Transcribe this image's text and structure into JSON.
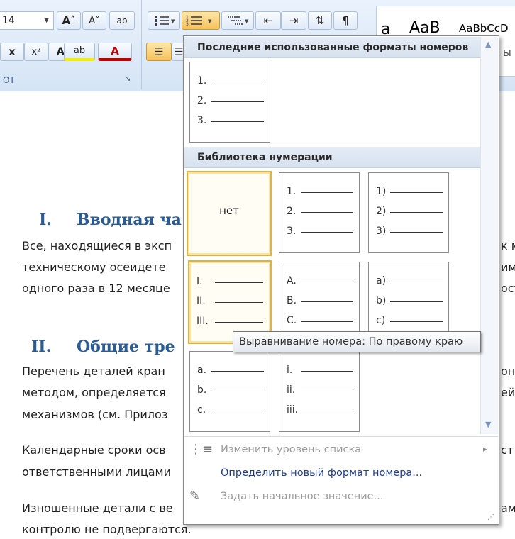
{
  "ribbon": {
    "font_size": "14",
    "grow_font": "A˄",
    "shrink_font": "A˅",
    "clear_format": "ab",
    "superscript": "x²",
    "change_case": "Aa",
    "highlight": "ab",
    "font_color": "A",
    "pilcrow": "¶",
    "group_label_left": "ОТ",
    "group_label_icon": "↘",
    "styles": [
      "a",
      "AaB",
      "AaBbCcD"
    ],
    "style_overflow": "ы"
  },
  "document": {
    "heading1_num": "I.",
    "heading1_text": "Вводная ча",
    "para1": [
      "Все, находящиеся в эксп",
      "техническому осеидете",
      "одного раза в 12 месяце"
    ],
    "para1_right": [
      "к м",
      "име",
      "ост"
    ],
    "heading2_num": "II.",
    "heading2_text": "Общие тре",
    "para2": [
      "Перечень деталей кран",
      "методом, определяется",
      "механизмов (см. Прилоз"
    ],
    "para2_right": [
      "он",
      "ей"
    ],
    "para3": [
      "Календарные сроки осв",
      "ответственными лицами"
    ],
    "para3_right": [
      "ст"
    ],
    "para4": [
      "Изношенные детали с ве",
      "контролю не подвергаются."
    ],
    "para4_right": [
      "ам"
    ]
  },
  "menu": {
    "recent_header": "Последние использованные форматы номеров",
    "recent_tiles": [
      {
        "rows": [
          "1.",
          "2.",
          "3."
        ]
      }
    ],
    "library_header": "Библиотека нумерации",
    "none_label": "нет",
    "library_tiles": [
      {
        "rows": [
          "1.",
          "2.",
          "3."
        ]
      },
      {
        "rows": [
          "1)",
          "2)",
          "3)"
        ]
      },
      {
        "rows": [
          "I.",
          "II.",
          "III."
        ]
      },
      {
        "rows": [
          "A.",
          "B.",
          "C."
        ]
      },
      {
        "rows": [
          "a)",
          "b)",
          "c)"
        ]
      },
      {
        "rows": [
          "a.",
          "b.",
          "c."
        ]
      },
      {
        "rows": [
          "i.",
          "ii.",
          "iii."
        ]
      }
    ],
    "items": [
      {
        "label": "Изменить уровень списка",
        "enabled": false,
        "submenu": "▸"
      },
      {
        "label": "Определить новый формат номера...",
        "enabled": true
      },
      {
        "label": "Задать начальное значение...",
        "enabled": false
      }
    ]
  },
  "tooltip": "Выравнивание номера: По правому краю",
  "icons": [
    "bullets-icon",
    "numbering-icon",
    "multilevel-list-icon",
    "decrease-indent-icon",
    "increase-indent-icon",
    "sort-icon",
    "pilcrow-icon",
    "align-left-icon",
    "scroll-up-icon",
    "scroll-down-icon",
    "change-level-icon",
    "set-value-icon"
  ],
  "colors": {
    "accent": "#2b5b93",
    "highlight_selected": "#e2b23e",
    "tooltip_border": "#767676"
  }
}
